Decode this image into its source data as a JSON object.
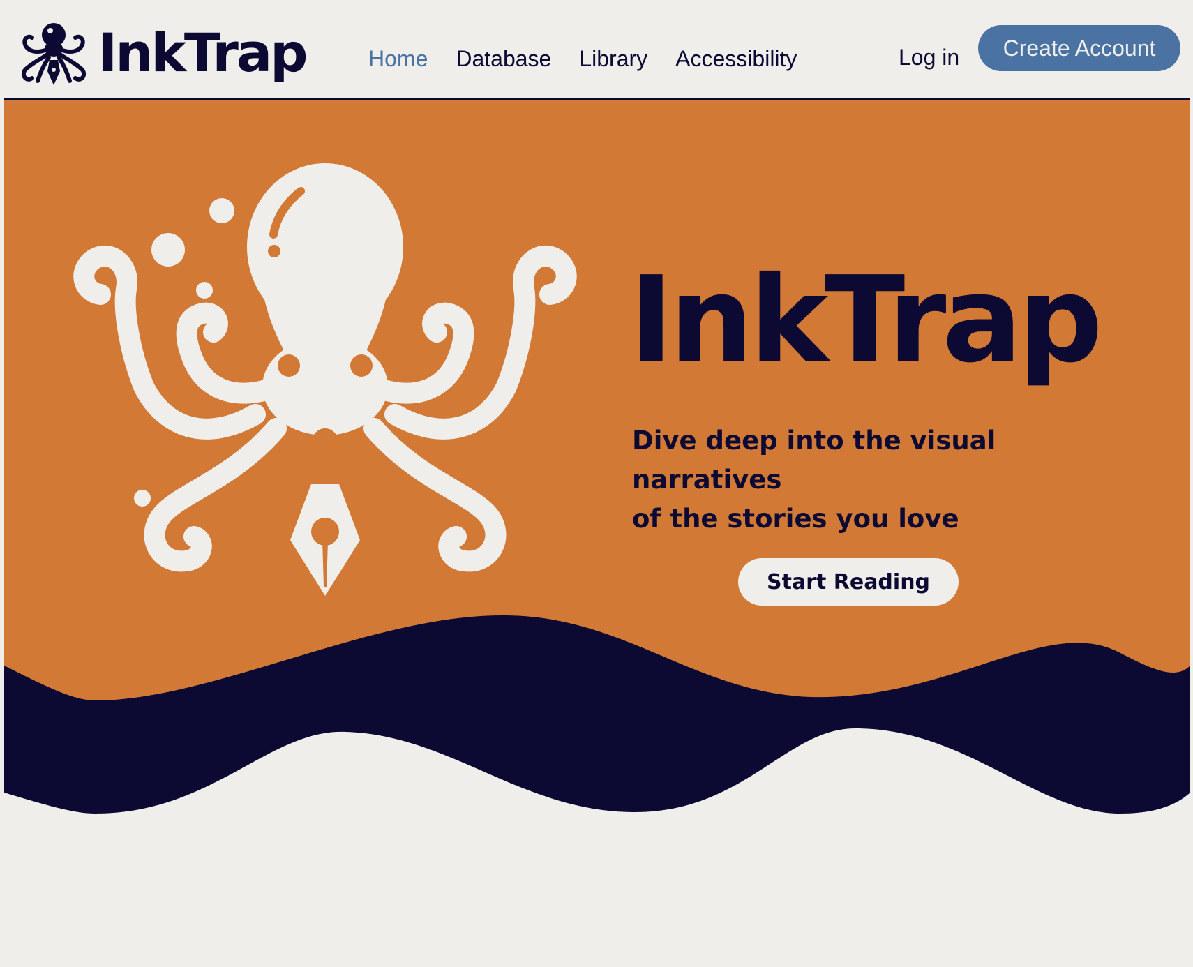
{
  "header": {
    "brand": "InkTrap",
    "nav": [
      {
        "label": "Home",
        "active": true
      },
      {
        "label": "Database",
        "active": false
      },
      {
        "label": "Library",
        "active": false
      },
      {
        "label": "Accessibility",
        "active": false
      }
    ],
    "login_label": "Log in",
    "create_account_label": "Create Account"
  },
  "hero": {
    "title": "InkTrap",
    "tagline_line1": "Dive deep into the visual narratives",
    "tagline_line2": "of the stories you love",
    "cta_label": "Start Reading",
    "illustration": "octopus-pen-nib-icon"
  },
  "colors": {
    "navy": "#0c0a33",
    "orange": "#d27936",
    "cream": "#f0eeeb",
    "blue": "#4a73a3"
  }
}
